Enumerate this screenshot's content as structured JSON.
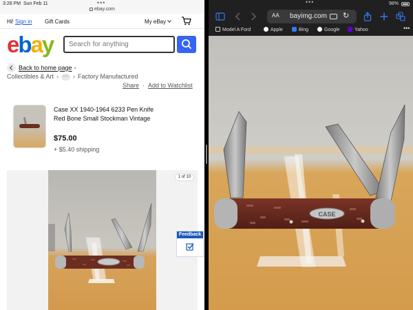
{
  "left_pane": {
    "status_bar": {
      "time": "3:28 PM",
      "date": "Sun Feb 11",
      "dots": "•••",
      "url": "ebay.com"
    },
    "top_nav": {
      "greeting": "Hi!",
      "sign_in": "Sign in",
      "gift_cards": "Gift Cards",
      "my_ebay": "My eBay",
      "cart_icon": "cart-icon"
    },
    "logo": {
      "letters": [
        "e",
        "b",
        "a",
        "y"
      ],
      "colors": [
        "#e53238",
        "#0064d2",
        "#f5af02",
        "#86b817"
      ]
    },
    "search": {
      "placeholder": "Search for anything",
      "button_icon": "search-icon",
      "button_color": "#3665f3"
    },
    "back_link": {
      "label": "Back to home page",
      "separator": "•"
    },
    "breadcrumb": {
      "first": "Collectibles & Art",
      "more": "···",
      "last": "Factory Manufactured"
    },
    "actions": {
      "share": "Share",
      "separator": "·",
      "watchlist": "Add to Watchlist"
    },
    "item": {
      "title": "Case XX 1940-1964 6233 Pen Knife Red Bone Small Stockman Vintage",
      "price": "$75.00",
      "shipping": "+ $5.40 shipping"
    },
    "gallery": {
      "counter": "1 of 10"
    },
    "feedback": {
      "label": "Feedback",
      "icon": "feedback-checkbox-icon"
    }
  },
  "right_pane": {
    "status_bar": {
      "dots": "•••",
      "battery": "98%"
    },
    "toolbar": {
      "text_size": "AA",
      "host": "bayimg.com",
      "icons": [
        "sidebar-icon",
        "back-icon",
        "forward-icon",
        "reader-icon",
        "reload-icon",
        "share-icon",
        "new-tab-icon",
        "tabs-icon"
      ]
    },
    "bookmarks": [
      {
        "label": "Model A Ford",
        "icon": "folder-icon"
      },
      {
        "label": "Apple",
        "icon": "apple-icon"
      },
      {
        "label": "Bing",
        "icon": "bing-icon"
      },
      {
        "label": "Google",
        "icon": "google-icon"
      },
      {
        "label": "Yahoo",
        "icon": "yahoo-icon"
      }
    ],
    "bookmarks_more": "•••",
    "photo": {
      "knife_brand": "CASE"
    }
  },
  "colors": {
    "link_blue": "#1a57d6",
    "ebay_blue": "#3665f3",
    "feedback_blue": "#1e5bb8",
    "knife_handle": "#6b2d20"
  }
}
